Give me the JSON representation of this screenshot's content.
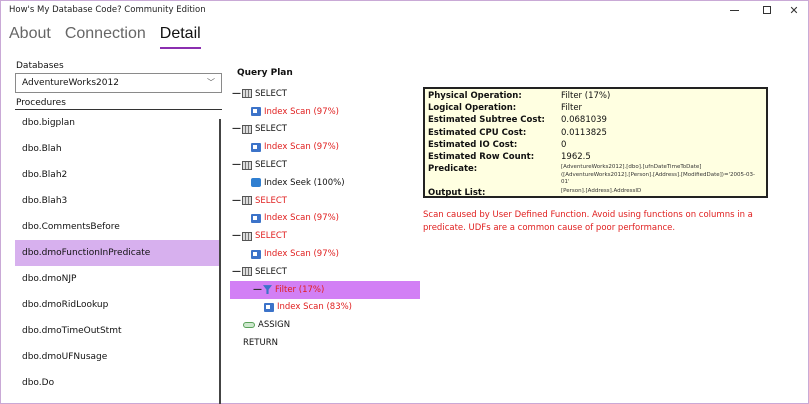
{
  "window": {
    "title": "How's My Database Code? Community Edition"
  },
  "tabs": [
    {
      "label": "About"
    },
    {
      "label": "Connection"
    },
    {
      "label": "Detail"
    }
  ],
  "database": {
    "label": "Databases",
    "selected": "AdventureWorks2012"
  },
  "procedures": {
    "label": "Procedures",
    "items": [
      "dbo.bigplan",
      "dbo.Blah",
      "dbo.Blah2",
      "dbo.Blah3",
      "dbo.CommentsBefore",
      "dbo.dmoFunctionInPredicate",
      "dbo.dmoNJP",
      "dbo.dmoRidLookup",
      "dbo.dmoTimeOutStmt",
      "dbo.dmoUFNusage",
      "dbo.Do"
    ],
    "selected_index": 5
  },
  "query_plan": {
    "title": "Query Plan",
    "nodes": [
      {
        "text": "SELECT",
        "icon": "table-icon",
        "expander": "—",
        "level": 0,
        "red": false
      },
      {
        "text": "Index Scan (97%)",
        "icon": "index-scan-icon",
        "level": 1,
        "red": true
      },
      {
        "text": "SELECT",
        "icon": "table-icon",
        "expander": "—",
        "level": 0,
        "red": false
      },
      {
        "text": "Index Scan (97%)",
        "icon": "index-scan-icon",
        "level": 1,
        "red": true
      },
      {
        "text": "SELECT",
        "icon": "table-icon",
        "expander": "—",
        "level": 0,
        "red": false
      },
      {
        "text": "Index Seek (100%)",
        "icon": "index-seek-icon",
        "level": 1,
        "red": false
      },
      {
        "text": "SELECT",
        "icon": "table-icon",
        "expander": "—",
        "level": 0,
        "red": true
      },
      {
        "text": "Index Scan (97%)",
        "icon": "index-scan-icon",
        "level": 1,
        "red": true
      },
      {
        "text": "SELECT",
        "icon": "table-icon",
        "expander": "—",
        "level": 0,
        "red": true
      },
      {
        "text": "Index Scan (97%)",
        "icon": "index-scan-icon",
        "level": 1,
        "red": true
      },
      {
        "text": "SELECT",
        "icon": "table-icon",
        "expander": "—",
        "level": 0,
        "red": false
      },
      {
        "text": "Filter (17%)",
        "icon": "filter-icon",
        "expander": "—",
        "level": 1,
        "red": true,
        "selected": true
      },
      {
        "text": "Index Scan (83%)",
        "icon": "index-scan-icon",
        "level": 2,
        "red": true
      },
      {
        "text": "ASSIGN",
        "icon": "assign-icon",
        "level": 0,
        "red": false
      },
      {
        "text": "RETURN",
        "icon": "",
        "level": 0,
        "red": false
      }
    ]
  },
  "details": {
    "physical_operation": {
      "key": "Physical Operation:",
      "value": "Filter (17%)"
    },
    "logical_operation": {
      "key": "Logical Operation:",
      "value": "Filter"
    },
    "subtree_cost": {
      "key": "Estimated Subtree Cost:",
      "value": "0.0681039"
    },
    "cpu_cost": {
      "key": "Estimated CPU Cost:",
      "value": "0.0113825"
    },
    "io_cost": {
      "key": "Estimated IO Cost:",
      "value": "0"
    },
    "row_count": {
      "key": "Estimated Row Count:",
      "value": "1962.5"
    },
    "predicate": {
      "key": "Predicate:",
      "value": "[AdventureWorks2012].[dbo].[ufnDateTimeToDate]([AdventureWorks2012].[Person].[Address].[ModifiedDate])='2005-03-01'"
    },
    "output_list": {
      "key": "Output List:",
      "value": "[Person].[Address].AddressID"
    }
  },
  "warning": "Scan caused by User Defined Function. Avoid using functions on columns in a predicate. UDFs are a common cause of poor performance.",
  "colors": {
    "accent": "#8b2fb0",
    "selected_list": "#d7b0ee",
    "selected_tree": "#d27ff5",
    "warning_red": "#e02020",
    "tooltip_bg": "#ffffe1"
  }
}
